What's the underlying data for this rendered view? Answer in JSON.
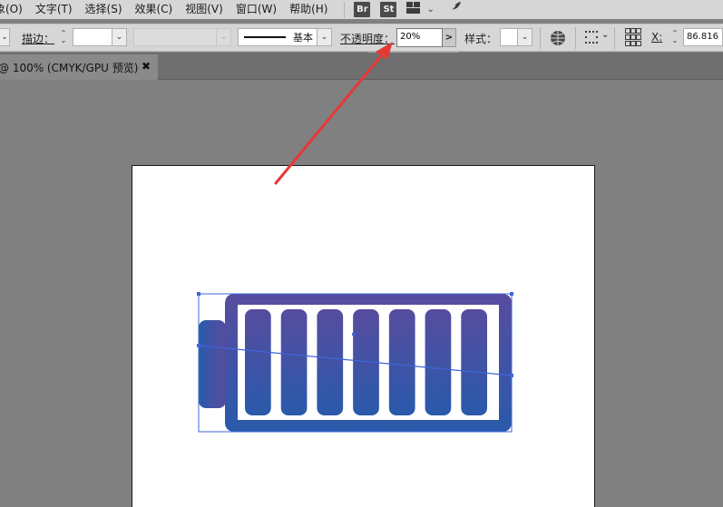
{
  "menu": {
    "items": [
      {
        "label": "象(O)"
      },
      {
        "label": "文字(T)"
      },
      {
        "label": "选择(S)"
      },
      {
        "label": "效果(C)"
      },
      {
        "label": "视图(V)"
      },
      {
        "label": "窗口(W)"
      },
      {
        "label": "帮助(H)"
      }
    ],
    "bridge_badge": "Br",
    "stock_badge": "St",
    "workspace_icon": "workspace-grid-icon",
    "feather_icon": "feather-icon"
  },
  "control": {
    "stroke_label": "描边：",
    "stroke_value": "",
    "variable_width_value": "",
    "brush_label": "基本",
    "opacity_label": "不透明度：",
    "opacity_value": "20%",
    "opacity_arrow": ">",
    "style_label": "样式：",
    "recolor_icon": "globe-recolor-icon",
    "align_icon": "align-dots-icon",
    "transform_icon": "reference-point-grid-icon",
    "x_label": "X:",
    "x_value": "86.816"
  },
  "opacity_slider": {
    "value_fraction": 0.02
  },
  "document_tab": {
    "label": "@ 100% (CMYK/GPU 预览)",
    "close_glyph": "✖"
  },
  "artwork": {
    "name": "battery-icon",
    "bars": 7,
    "gradient_top": "#574c9f",
    "gradient_bottom": "#2a5aab",
    "selection_color": "#3f65d9"
  },
  "annotation": {
    "arrow_color": "#e53935"
  }
}
